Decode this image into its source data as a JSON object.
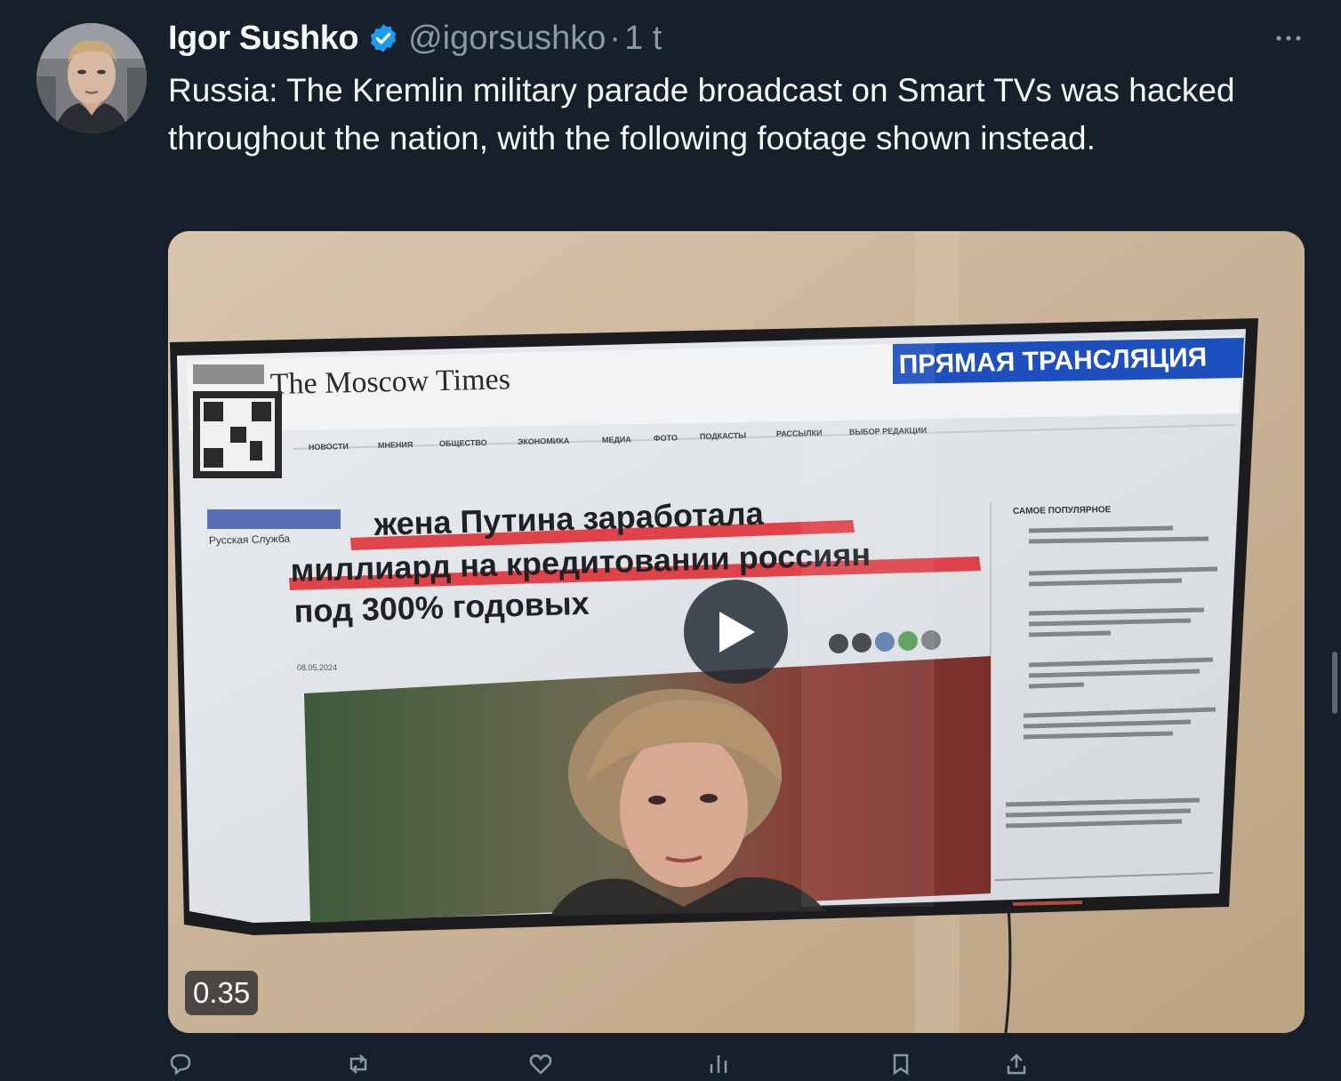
{
  "author": {
    "name": "Igor Sushko",
    "handle": "@igorsushko",
    "separator": "·",
    "time": "1 t",
    "verified_color": "#1d9bf0"
  },
  "tweet": {
    "text": "Russia: The Kremlin military parade broadcast on Smart TVs was hacked throughout the nation, with the following footage shown instead."
  },
  "media": {
    "kind": "video",
    "duration": "0.35",
    "screen_content": {
      "site_logo": "The Moscow Times",
      "live_banner": "ПРЯМАЯ ТРАНСЛЯЦИЯ",
      "headline_line1": "жена Путина заработала",
      "headline_line2": "миллиард на кредитовании россиян",
      "headline_line3": "под 300% годовых",
      "sidebar_title": "САМОЕ ПОПУЛЯРНОЕ",
      "nav_items": [
        "НОВОСТИ",
        "МНЕНИЯ",
        "ОБЩЕСТВО",
        "ЭКОНОМИКА",
        "МЕДИА",
        "ФОТО",
        "ПОДКАСТЫ",
        "РАССЫЛКИ",
        "ВЫБОР РЕДАКЦИИ"
      ],
      "side_label": "Русская Служба"
    }
  },
  "actions": {
    "icons": [
      "reply-icon",
      "retweet-icon",
      "like-icon",
      "views-icon",
      "bookmark-icon",
      "share-icon"
    ]
  },
  "colors": {
    "background": "#15202b",
    "text_primary": "#f7f9f9",
    "text_secondary": "#8b98a5",
    "accent": "#1d9bf0"
  }
}
